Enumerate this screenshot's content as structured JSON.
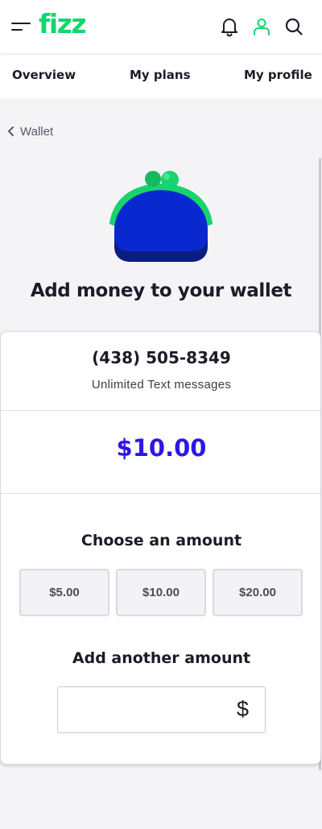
{
  "header": {
    "logo_text": "fizz",
    "menu_icon": "hamburger-menu-icon",
    "notification_icon": "bell-icon",
    "profile_icon": "user-icon",
    "search_icon": "search-icon",
    "brand_color": "#12d66f"
  },
  "tabs": [
    {
      "label": "Overview"
    },
    {
      "label": "My plans"
    },
    {
      "label": "My profile"
    }
  ],
  "breadcrumb": {
    "icon": "chevron-left-icon",
    "label": "Wallet"
  },
  "page": {
    "title": "Add money to your wallet"
  },
  "account": {
    "phone_number": "(438) 505-8349",
    "plan": "Unlimited Text messages"
  },
  "amount": {
    "selected_display": "$10.00",
    "accent_color": "#2d16e6"
  },
  "choose_amount": {
    "title": "Choose an amount",
    "options": [
      {
        "label": "$5.00"
      },
      {
        "label": "$10.00"
      },
      {
        "label": "$20.00"
      }
    ]
  },
  "custom_amount": {
    "title": "Add another amount",
    "value": "",
    "currency_symbol": "$"
  }
}
